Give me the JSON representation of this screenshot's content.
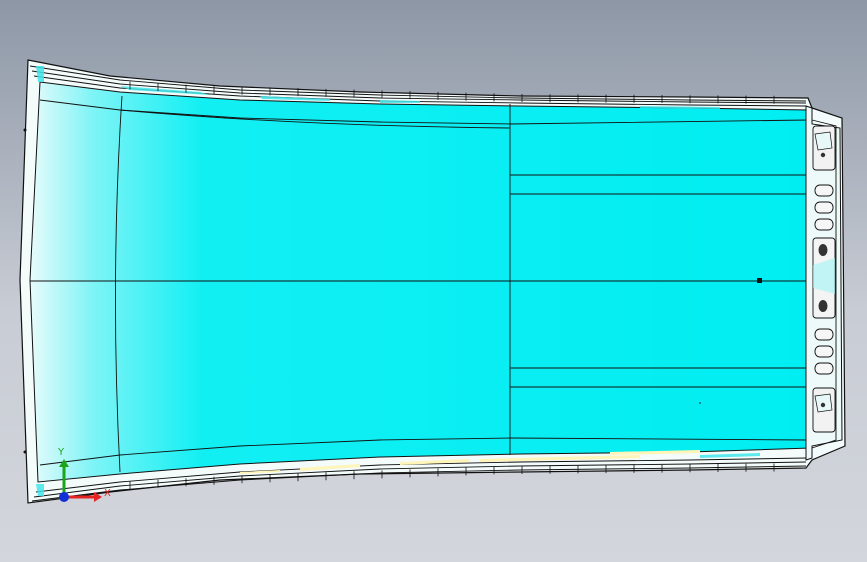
{
  "viewport": {
    "background_top": "#8d97a6",
    "background_bottom": "#d3d6dc"
  },
  "model": {
    "surface_color": "#00f2f5",
    "edge_color": "#111111",
    "flange_color": "#ffffff",
    "highlight_color": "#fff7c4",
    "icons": [
      "roof-panel-model",
      "mounting-bracket-icon",
      "slot-icon",
      "hole-icon"
    ]
  },
  "triad": {
    "x_label": "X",
    "y_label": "Y",
    "x_color": "#e52521",
    "y_color": "#1aa51a",
    "origin_color": "#1230d6"
  }
}
